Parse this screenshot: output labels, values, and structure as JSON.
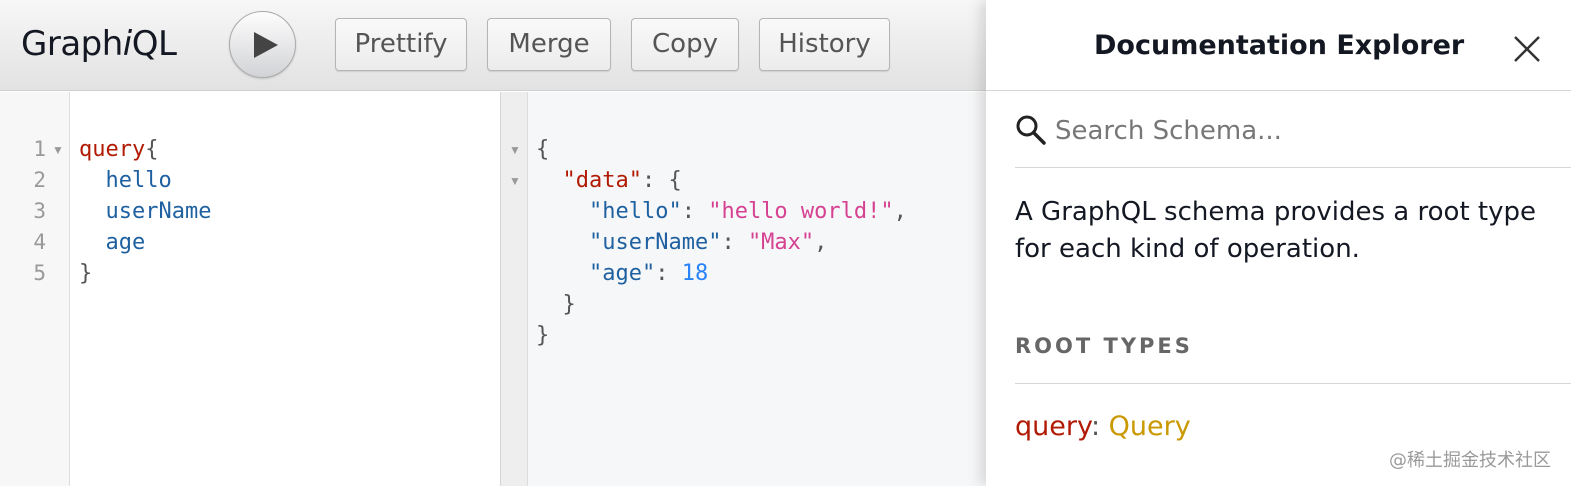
{
  "app": {
    "logo_prefix": "Graph",
    "logo_italic": "i",
    "logo_suffix": "QL"
  },
  "toolbar": {
    "run_icon": "play-icon",
    "prettify_label": "Prettify",
    "merge_label": "Merge",
    "copy_label": "Copy",
    "history_label": "History"
  },
  "editor": {
    "line_numbers": [
      "1",
      "2",
      "3",
      "4",
      "5"
    ],
    "fold_icon": "fold-triangle-icon",
    "lines": {
      "l1_keyword": "query",
      "l1_brace": "{",
      "l2_field": "hello",
      "l3_field": "userName",
      "l4_field": "age",
      "l5_brace": "}"
    }
  },
  "result": {
    "open_brace": "{",
    "data_key": "\"data\"",
    "data_sep": ": {",
    "hello_key": "\"hello\"",
    "hello_value": "\"hello world!\"",
    "username_key": "\"userName\"",
    "username_value": "\"Max\"",
    "age_key": "\"age\"",
    "age_value": "18",
    "colon": ": ",
    "comma": ",",
    "inner_close": "}",
    "outer_close": "}"
  },
  "docs": {
    "title": "Documentation Explorer",
    "close_icon": "close-icon",
    "search_icon": "search-icon",
    "search_placeholder": "Search Schema...",
    "description": "A GraphQL schema provides a root type for each kind of operation.",
    "root_types_heading": "ROOT TYPES",
    "root_name": "query",
    "root_colon": ": ",
    "root_type": "Query"
  },
  "watermark": "@稀土掘金技术社区",
  "colors": {
    "keyword": "#b11a04",
    "field": "#1f61a0",
    "string": "#d64292",
    "number": "#2882f9",
    "type_link": "#ca9800"
  }
}
